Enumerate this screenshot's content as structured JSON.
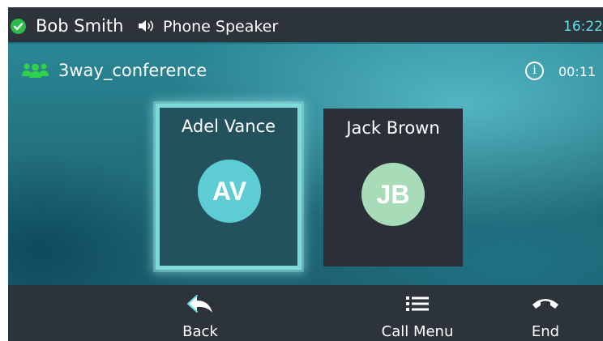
{
  "status_bar": {
    "user_name": "Bob Smith",
    "audio_mode": "Phone Speaker",
    "clock": "16:22",
    "status_color": "#2dbb4c"
  },
  "conference": {
    "name": "3way_conference",
    "duration": "00:11",
    "icon": "group-icon",
    "info_icon_glyph": "i"
  },
  "participants": [
    {
      "name": "Adel Vance",
      "initials": "AV",
      "avatar_color": "#5dcdd3",
      "selected": true
    },
    {
      "name": "Jack Brown",
      "initials": "JB",
      "avatar_color": "#a8dcb8",
      "selected": false
    }
  ],
  "softkeys": [
    {
      "label": "Back",
      "icon": "back-arrow-icon"
    },
    {
      "label": "Call Menu",
      "icon": "list-menu-icon"
    },
    {
      "label": "End",
      "icon": "hang-up-icon"
    }
  ],
  "colors": {
    "accent": "#5fe0e6",
    "bar_background": "#2c333b",
    "card_background": "#2a2f3a"
  }
}
